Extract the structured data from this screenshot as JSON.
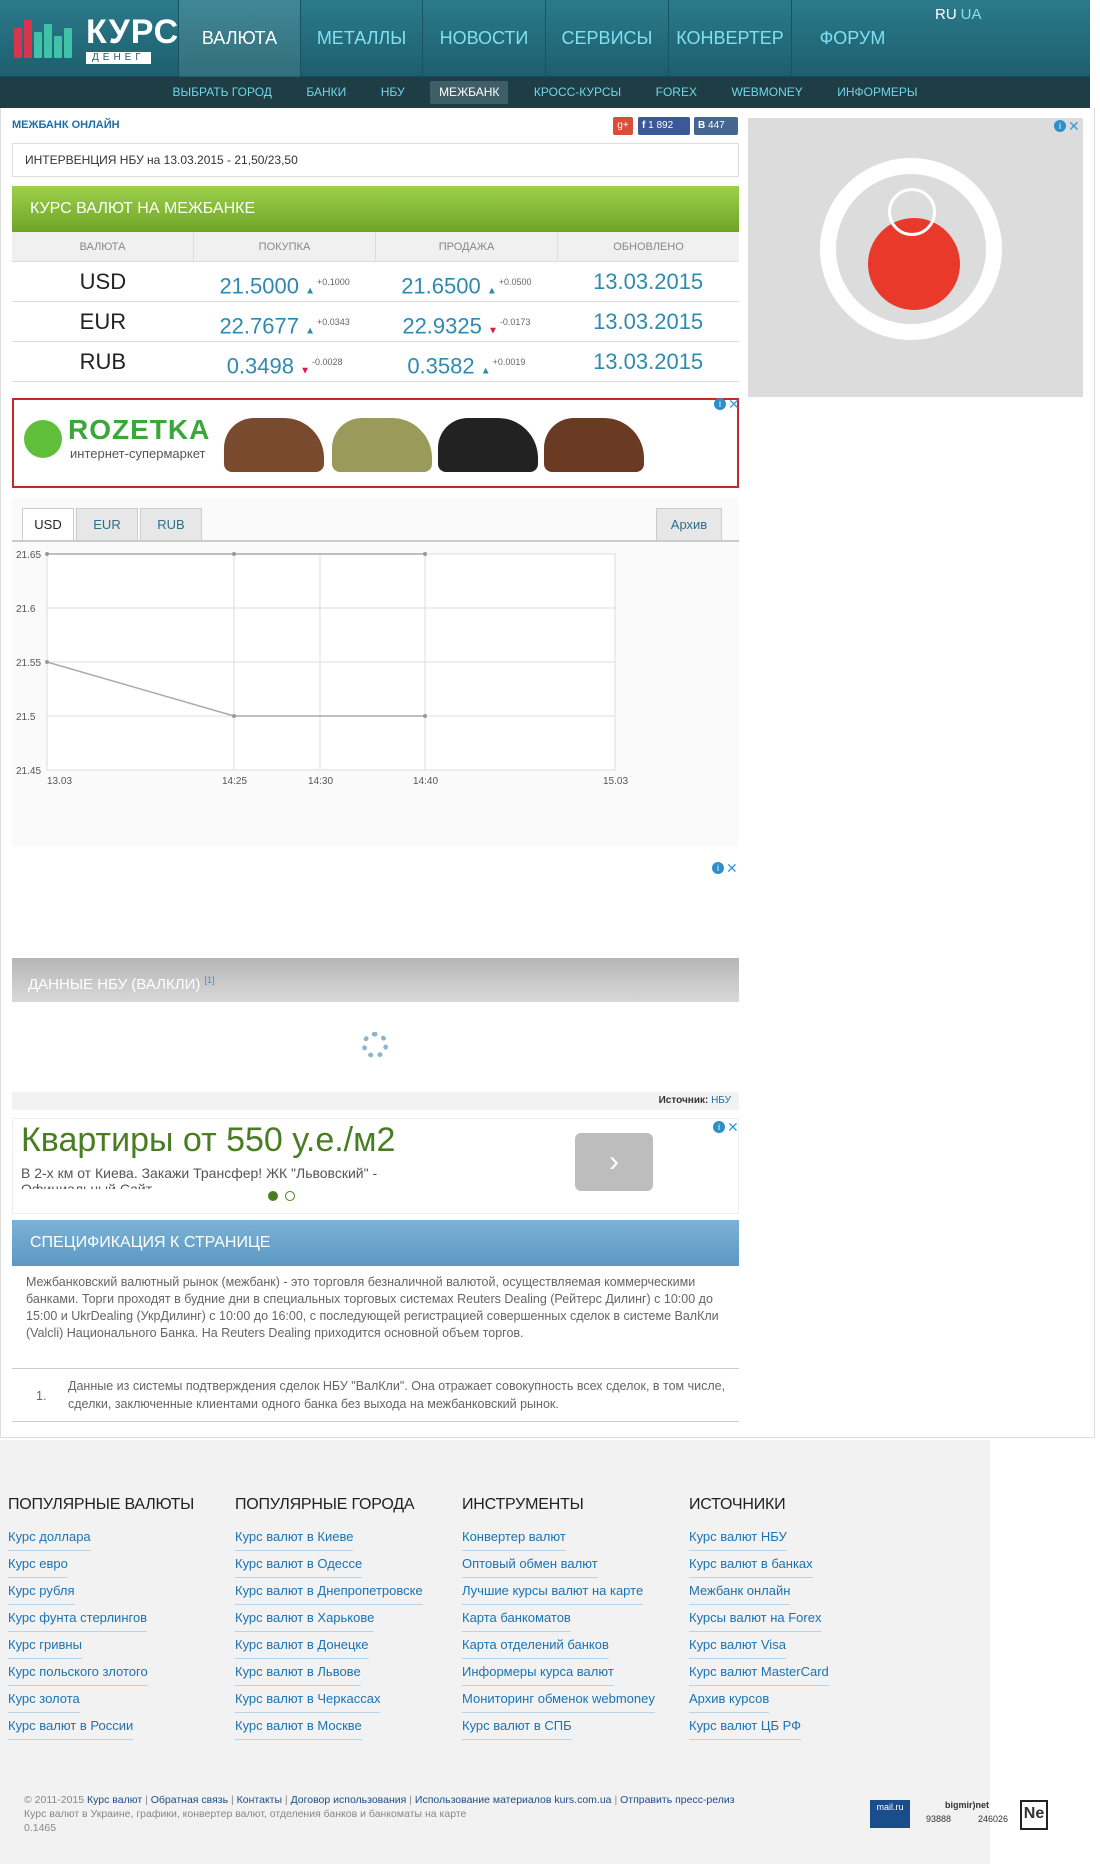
{
  "header": {
    "logo_main": "КУРС",
    "logo_sub": "ДЕНЕГ",
    "nav": [
      "ВАЛЮТА",
      "МЕТАЛЛЫ",
      "НОВОСТИ",
      "СЕРВИСЫ",
      "КОНВЕРТЕР",
      "ФОРУМ"
    ],
    "lang_ru": "RU",
    "lang_ua": "UA"
  },
  "subnav": [
    "ВЫБРАТЬ ГОРОД",
    "БАНКИ",
    "НБУ",
    "МЕЖБАНК",
    "КРОСС-КУРСЫ",
    "FOREX",
    "WEBMONEY",
    "ИНФОРМЕРЫ"
  ],
  "main": {
    "title": "МЕЖБАНК ОНЛАЙН",
    "social": {
      "fb_count": "1 892",
      "vk_count": "447"
    },
    "intervention": "ИНТЕРВЕНЦИЯ НБУ на 13.03.2015 - 21,50/23,50",
    "rates_title": "КУРС ВАЛЮТ НА МЕЖБАНКЕ",
    "table_headers": [
      "ВАЛЮТА",
      "ПОКУПКА",
      "ПРОДАЖА",
      "ОБНОВЛЕНО"
    ],
    "rows": [
      {
        "cur": "USD",
        "buy": "21.5000",
        "buy_delta": "+0.1000",
        "buy_dir": "up",
        "sell": "21.6500",
        "sell_delta": "+0.0500",
        "sell_dir": "up",
        "updated": "13.03.2015"
      },
      {
        "cur": "EUR",
        "buy": "22.7677",
        "buy_delta": "+0.0343",
        "buy_dir": "up",
        "sell": "22.9325",
        "sell_delta": "-0.0173",
        "sell_dir": "down",
        "updated": "13.03.2015"
      },
      {
        "cur": "RUB",
        "buy": "0.3498",
        "buy_delta": "-0.0028",
        "buy_dir": "down",
        "sell": "0.3582",
        "sell_delta": "+0.0019",
        "sell_dir": "up",
        "updated": "13.03.2015"
      }
    ],
    "ad_rozetka": {
      "brand": "ROZETKA",
      "tagline": "интернет-супермаркет"
    },
    "chart_tabs": [
      "USD",
      "EUR",
      "RUB"
    ],
    "archive_label": "Архив",
    "nbu_title": "ДАННЫЕ НБУ (ВАЛКЛИ)",
    "nbu_note_ref": "[1]",
    "source_label": "Источник:",
    "source_link": "НБУ",
    "ad_flats": {
      "headline": "Квартиры от 550 у.е./м2",
      "text": "В 2-х км от Киева. Закажи Трансфер! ЖК \"Львовский\" -",
      "text2": "Официальный Сайт"
    },
    "spec_title": "СПЕЦИФИКАЦИЯ К СТРАНИЦЕ",
    "spec_text": "Межбанковский валютный рынок (межбанк) - это торговля безналичной валютой, осуществляемая коммерческими банками. Торги проходят в будние дни в специальных торговых системах Reuters Dealing (Рейтерс Дилинг) с 10:00 до 15:00 и UkrDealing (УкрДилинг) с 10:00 до 16:00, с последующей регистрацией совершенных сделок в системе ВалКли (Valcli) Национального Банка. На Reuters Dealing приходится основной объем торгов.",
    "spec_note_num": "1.",
    "spec_note": "Данные из системы подтверждения сделок НБУ \"ВалКли\". Она отражает совокупность всех сделок, в том числе, сделки, заключенные клиентами одного банка без выхода на межбанковский рынок."
  },
  "chart_data": {
    "type": "line",
    "x_ticks": [
      "13.03",
      "14:25",
      "14:30",
      "14:40",
      "15.03"
    ],
    "y_ticks": [
      "21.65",
      "21.6",
      "21.55",
      "21.5",
      "21.45"
    ],
    "ylim": [
      21.45,
      21.65
    ],
    "series": [
      {
        "values": [
          [
            0,
            21.65
          ],
          [
            1,
            21.65
          ],
          [
            3,
            21.65
          ]
        ],
        "color": "#aaaaaa"
      },
      {
        "values": [
          [
            0,
            21.55
          ],
          [
            1,
            21.5
          ],
          [
            3,
            21.5
          ]
        ],
        "color": "#aaaaaa"
      }
    ]
  },
  "footer": {
    "cols": [
      {
        "title": "ПОПУЛЯРНЫЕ ВАЛЮТЫ",
        "links": [
          "Курс доллара",
          "Курс евро",
          "Курс рубля",
          "Курс фунта стерлингов",
          "Курс гривны",
          "Курс польского злотого",
          "Курс золота",
          "Курс валют в России"
        ]
      },
      {
        "title": "ПОПУЛЯРНЫЕ ГОРОДА",
        "links": [
          "Курс валют в Киеве",
          "Курс валют в Одессе",
          "Курс валют в Днепропетровске",
          "Курс валют в Харькове",
          "Курс валют в Донецке",
          "Курс валют в Львове",
          "Курс валют в Черкассах",
          "Курс валют в Москве"
        ]
      },
      {
        "title": "ИНСТРУМЕНТЫ",
        "links": [
          "Конвертер валют",
          "Оптовый обмен валют",
          "Лучшие курсы валют на карте",
          "Карта банкоматов",
          "Карта отделений банков",
          "Информеры курса валют",
          "Мониторинг обменок webmoney",
          "Курс валют в СПБ"
        ]
      },
      {
        "title": "ИСТОЧНИКИ",
        "links": [
          "Курс валют НБУ",
          "Курс валют в банках",
          "Межбанк онлайн",
          "Курсы валют на Forex",
          "Курс валют Visa",
          "Курс валют MasterCard",
          "Архив курсов",
          "Курс валют ЦБ РФ"
        ]
      }
    ],
    "copyright_prefix": "© 2011-2015",
    "copyright_links": [
      "Курс валют",
      "Обратная связь",
      "Контакты",
      "Договор использования",
      "Использование материалов kurs.com.ua",
      "Отправить пресс-релиз"
    ],
    "tagline": "Курс валют в Украине, графики, конвертер валют, отделения банков и банкоматы на карте",
    "version": "0.1465",
    "bigmir_label": "bigmir)net",
    "bigmir_counts": [
      "93888",
      "246026"
    ]
  }
}
